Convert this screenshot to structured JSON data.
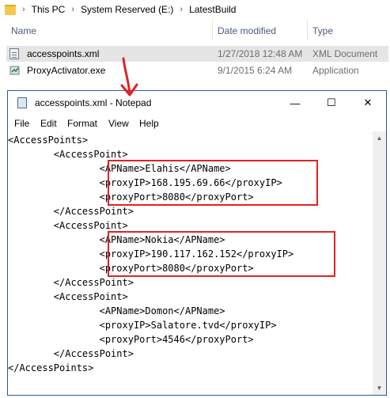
{
  "explorer": {
    "breadcrumb": [
      "This PC",
      "System Reserved (E:)",
      "LatestBuild"
    ],
    "columns": {
      "name": "Name",
      "date_modified": "Date modified",
      "type": "Type"
    },
    "files": [
      {
        "name": "accesspoints.xml",
        "date": "1/27/2018 12:48 AM",
        "type": "XML Document",
        "icon": "xml-file-icon",
        "selected": true
      },
      {
        "name": "ProxyActivator.exe",
        "date": "9/1/2015 6:24 AM",
        "type": "Application",
        "icon": "exe-file-icon",
        "selected": false
      }
    ]
  },
  "notepad": {
    "title": "accesspoints.xml - Notepad",
    "window_buttons": {
      "minimize": "—",
      "maximize": "☐",
      "close": "✕"
    },
    "menu": [
      "File",
      "Edit",
      "Format",
      "View",
      "Help"
    ],
    "lines": [
      "<AccessPoints>",
      "        <AccessPoint>",
      "                <APName>Elahis</APName>",
      "                <proxyIP>168.195.69.66</proxyIP>",
      "                <proxyPort>8080</proxyPort>",
      "        </AccessPoint>",
      "        <AccessPoint>",
      "                <APName>Nokia</APName>",
      "                <proxyIP>190.117.162.152</proxyIP>",
      "                <proxyPort>8080</proxyPort>",
      "        </AccessPoint>",
      "        <AccessPoint>",
      "                <APName>Domon</APName>",
      "                <proxyIP>Salatore.tvd</proxyIP>",
      "                <proxyPort>4546</proxyPort>",
      "        </AccessPoint>",
      "</AccessPoints>"
    ]
  },
  "colors": {
    "highlight_box": "#e02323",
    "annotation_arrow": "#e02323",
    "selected_row": "#e5e5e5"
  }
}
